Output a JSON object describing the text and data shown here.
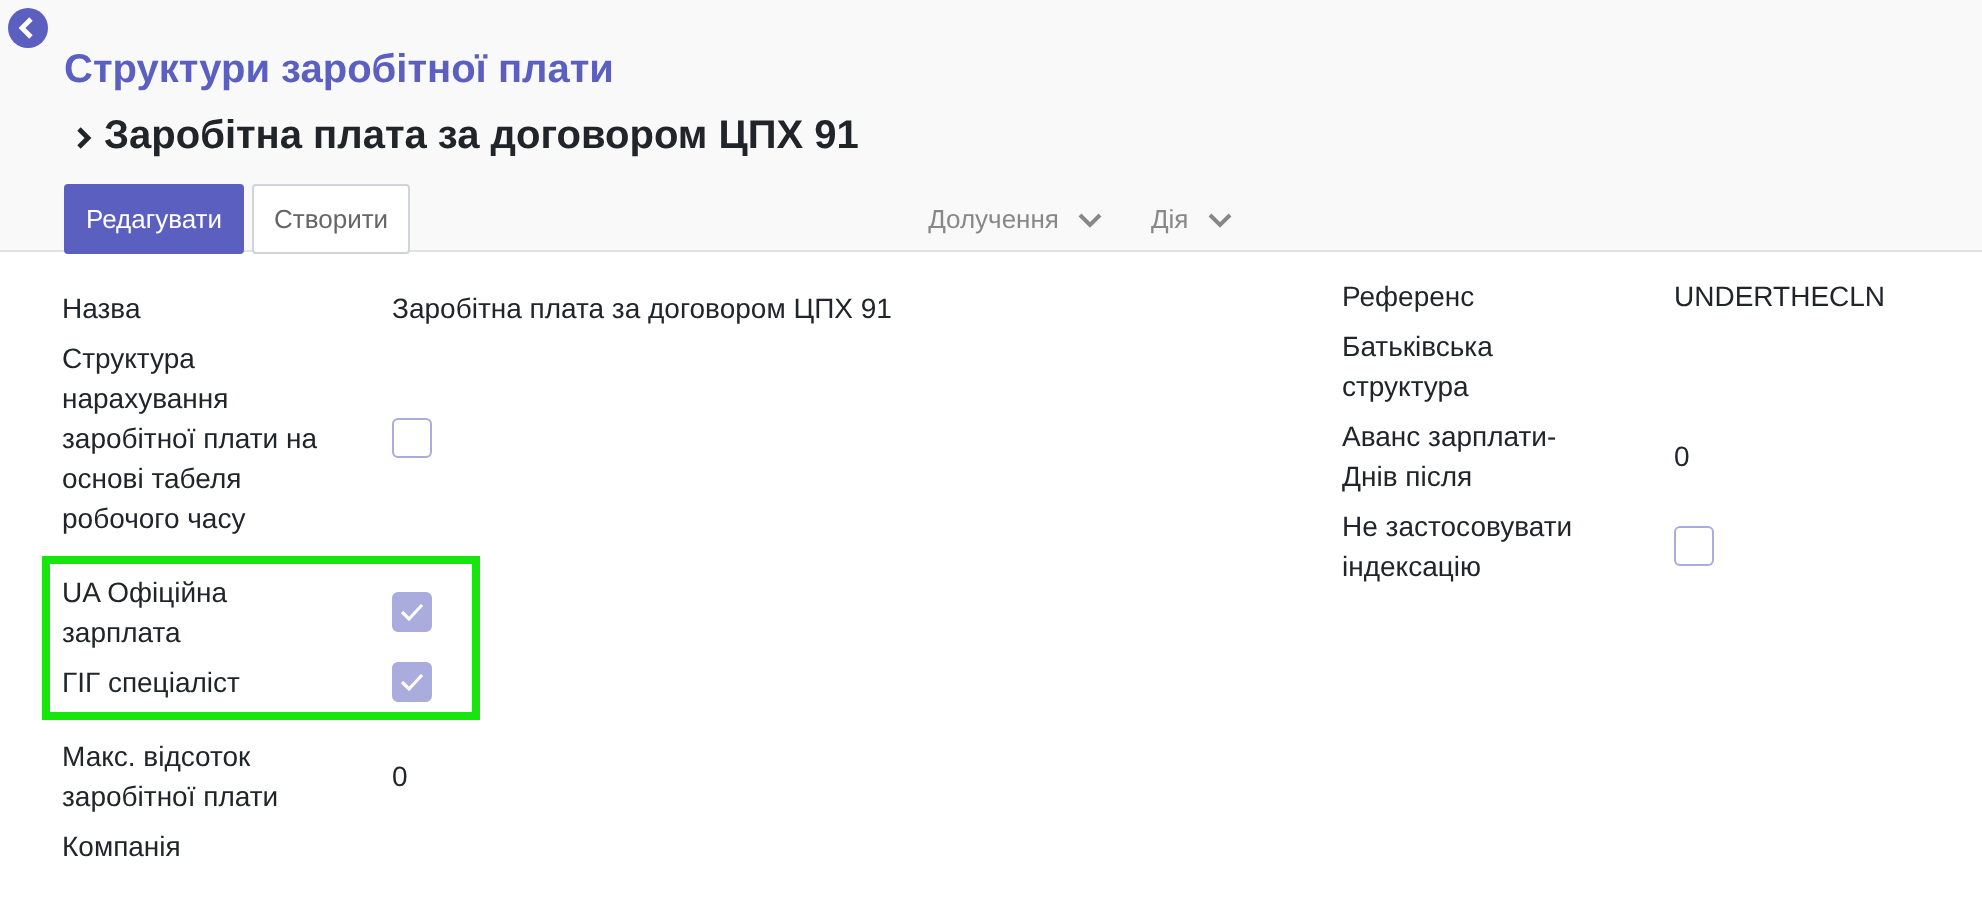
{
  "breadcrumb": {
    "parent": "Структури заробітної плати",
    "current": "Заробітна плата за договором ЦПХ 91"
  },
  "buttons": [
    {
      "label": "Редагувати",
      "primary": true
    },
    {
      "label": "Створити",
      "primary": false
    }
  ],
  "menus": [
    {
      "label": "Долучення"
    },
    {
      "label": "Дія"
    }
  ],
  "left_sections": [
    {
      "highlighted": false,
      "fields": [
        {
          "label": "Назва",
          "kind": "text",
          "value": "Заробітна плата за договором ЦПХ 91"
        },
        {
          "label": "Структура нарахування заробітної плати на основі табеля робочого часу",
          "kind": "checkbox",
          "checked": false
        }
      ]
    },
    {
      "highlighted": true,
      "fields": [
        {
          "label": "UA Офіційна зарплата",
          "kind": "checkbox",
          "checked": true
        },
        {
          "label": "ГІГ спеціаліст",
          "kind": "checkbox",
          "checked": true
        }
      ]
    },
    {
      "highlighted": false,
      "fields": [
        {
          "label": "Макс. відсоток заробітної плати",
          "kind": "text",
          "value": "0"
        },
        {
          "label": "Компанія",
          "kind": "empty"
        }
      ]
    }
  ],
  "right_fields": [
    {
      "label": "Референс",
      "kind": "text",
      "value": "UNDERTHECLN"
    },
    {
      "label": "Батьківська структура",
      "kind": "empty"
    },
    {
      "label": "Аванс зарплати-Днів після",
      "kind": "text",
      "value": "0"
    },
    {
      "label": "Не застосовувати індексацію",
      "kind": "checkbox",
      "checked": false
    }
  ]
}
